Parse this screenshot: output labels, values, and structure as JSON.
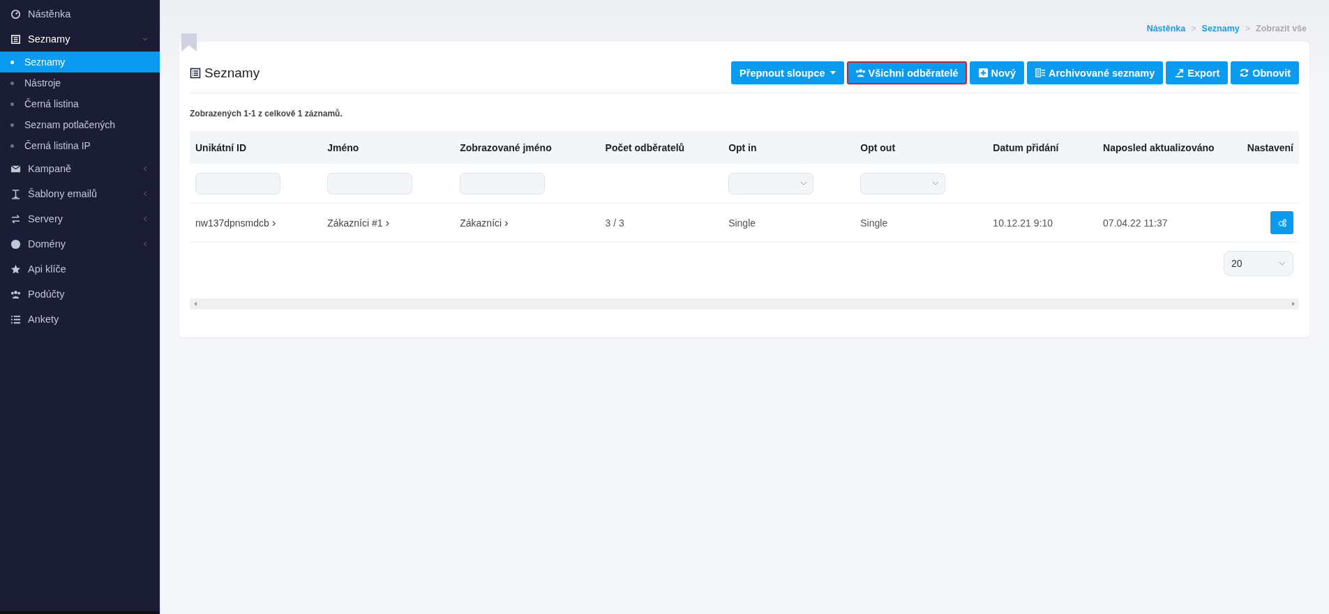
{
  "sidebar": {
    "items": [
      {
        "label": "Nástěnka",
        "expandable": false,
        "expanded": false
      },
      {
        "label": "Seznamy",
        "expandable": true,
        "expanded": true,
        "children": [
          {
            "label": "Seznamy",
            "selected": true
          },
          {
            "label": "Nástroje",
            "selected": false
          },
          {
            "label": "Černá listina",
            "selected": false
          },
          {
            "label": "Seznam potlačených",
            "selected": false
          },
          {
            "label": "Černá listina IP",
            "selected": false
          }
        ]
      },
      {
        "label": "Kampaně",
        "expandable": true,
        "expanded": false
      },
      {
        "label": "Šablony emailů",
        "expandable": true,
        "expanded": false
      },
      {
        "label": "Servery",
        "expandable": true,
        "expanded": false
      },
      {
        "label": "Domény",
        "expandable": true,
        "expanded": false
      },
      {
        "label": "Api klíče",
        "expandable": false,
        "expanded": false
      },
      {
        "label": "Podúčty",
        "expandable": false,
        "expanded": false
      },
      {
        "label": "Ankety",
        "expandable": false,
        "expanded": false
      }
    ]
  },
  "breadcrumb": [
    {
      "kind": "link",
      "label": "Nástěnka"
    },
    {
      "kind": "separator",
      "label": ">"
    },
    {
      "kind": "link",
      "label": "Seznamy"
    },
    {
      "kind": "separator",
      "label": ">"
    },
    {
      "kind": "current",
      "label": "Zobrazit vše"
    }
  ],
  "card": {
    "title": "Seznamy",
    "buttons": [
      {
        "label": "Přepnout sloupce",
        "highlighted": false
      },
      {
        "label": "Všichni odběratelé",
        "highlighted": true
      },
      {
        "label": "Nový",
        "highlighted": false
      },
      {
        "label": "Archivované seznamy",
        "highlighted": false
      },
      {
        "label": "Export",
        "highlighted": false
      },
      {
        "label": "Obnovit",
        "highlighted": false
      }
    ],
    "summary": "Zobrazených 1-1 z celkově 1 záznamů.",
    "table": {
      "columns": [
        {
          "label": "Unikátní ID",
          "kind": "text"
        },
        {
          "label": "Jméno",
          "kind": "text"
        },
        {
          "label": "Zobrazované jméno",
          "kind": "text"
        },
        {
          "label": "Počet odběratelů",
          "kind": "none"
        },
        {
          "label": "Opt in",
          "kind": "select"
        },
        {
          "label": "Opt out",
          "kind": "select"
        },
        {
          "label": "Datum přidání",
          "kind": "none"
        },
        {
          "label": "Naposled aktualizováno",
          "kind": "none"
        },
        {
          "label": "Nastavení",
          "kind": "none"
        }
      ],
      "rows": [
        {
          "cells": [
            {
              "kind": "link",
              "text": "nw137dpnsmdcb",
              "arrow": "›"
            },
            {
              "kind": "link",
              "text": "Zákazníci #1",
              "arrow": "›"
            },
            {
              "kind": "link",
              "text": "Zákazníci",
              "arrow": "›"
            },
            {
              "kind": "text",
              "text": "3 / 3"
            },
            {
              "kind": "text",
              "text": "Single"
            },
            {
              "kind": "text",
              "text": "Single"
            },
            {
              "kind": "text",
              "text": "10.12.21 9:10"
            },
            {
              "kind": "text",
              "text": "07.04.22 11:37"
            },
            {
              "kind": "settings"
            }
          ]
        }
      ]
    },
    "page_size": "20"
  }
}
